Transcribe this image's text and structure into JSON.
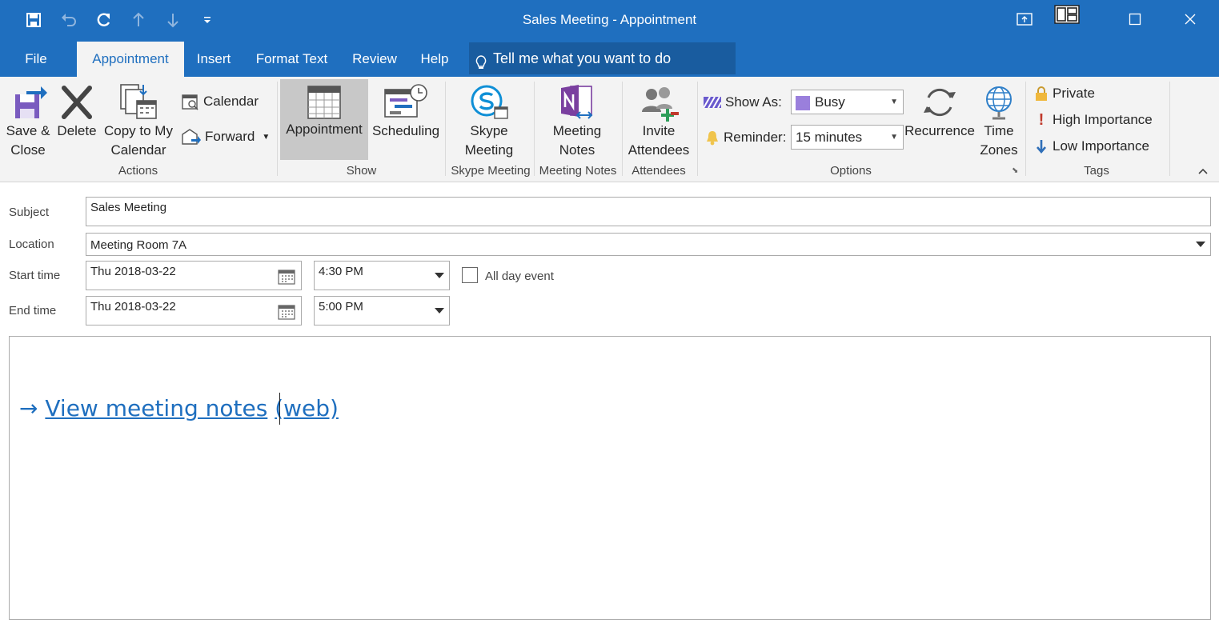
{
  "window": {
    "title": "Sales Meeting  -  Appointment"
  },
  "tabs": [
    {
      "label": "File"
    },
    {
      "label": "Appointment"
    },
    {
      "label": "Insert"
    },
    {
      "label": "Format Text"
    },
    {
      "label": "Review"
    },
    {
      "label": "Help"
    }
  ],
  "tellme": {
    "placeholder": "Tell me what you want to do"
  },
  "ribbon": {
    "actions": {
      "group": "Actions",
      "save_close": [
        "Save &",
        "Close"
      ],
      "delete": "Delete",
      "copy": [
        "Copy to My",
        "Calendar"
      ],
      "calendar": "Calendar",
      "forward": "Forward"
    },
    "show": {
      "group": "Show",
      "appointment": "Appointment",
      "scheduling": "Scheduling"
    },
    "skype": {
      "group": "Skype Meeting",
      "button": [
        "Skype",
        "Meeting"
      ]
    },
    "notes": {
      "group": "Meeting Notes",
      "button": [
        "Meeting",
        "Notes"
      ]
    },
    "attendees": {
      "group": "Attendees",
      "button": [
        "Invite",
        "Attendees"
      ]
    },
    "options": {
      "group": "Options",
      "show_as_label": "Show As:",
      "show_as_value": "Busy",
      "reminder_label": "Reminder:",
      "reminder_value": "15 minutes",
      "recurrence": "Recurrence",
      "timezones": [
        "Time",
        "Zones"
      ]
    },
    "tags": {
      "group": "Tags",
      "private": "Private",
      "high": "High Importance",
      "low": "Low Importance"
    }
  },
  "form": {
    "subject_label": "Subject",
    "subject_value": "Sales Meeting",
    "location_label": "Location",
    "location_value": "Meeting Room 7A",
    "start_label": "Start time",
    "start_date": "Thu 2018-03-22",
    "start_time": "4:30 PM",
    "end_label": "End time",
    "end_date": "Thu 2018-03-22",
    "end_time": "5:00 PM",
    "allday_label": "All day event"
  },
  "body": {
    "arrow": "→",
    "link_text": "View meeting notes",
    "link_suffix": "(web)"
  },
  "colors": {
    "accent": "#1f6fbf",
    "busy": "#9a7fdc",
    "high_importance": "#c0392b"
  }
}
